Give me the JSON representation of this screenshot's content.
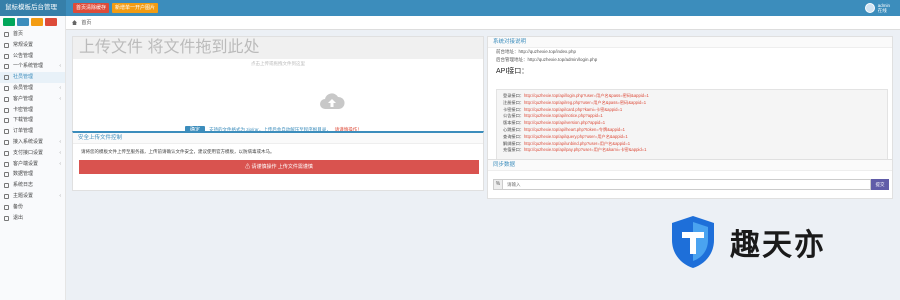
{
  "header": {
    "brand": "鼠标模板后台管理",
    "btn_red": "首页清除缓存",
    "btn_orange": "新增单一开户图片",
    "user_line1": "admin",
    "user_line2": "在线"
  },
  "sidebar": {
    "quick_colors": [
      "#00a65a",
      "#3c8dbc",
      "#f39c12",
      "#dd4b39"
    ],
    "items": [
      {
        "label": "首页",
        "has_children": false
      },
      {
        "label": "常规设置",
        "has_children": false
      },
      {
        "label": "公告管理",
        "has_children": false
      },
      {
        "label": "一个系统管理",
        "has_children": true
      },
      {
        "label": "社员管理",
        "has_children": false
      },
      {
        "label": "会员管理",
        "has_children": true
      },
      {
        "label": "客户管理",
        "has_children": true
      },
      {
        "label": "卡密管理",
        "has_children": false
      },
      {
        "label": "下载管理",
        "has_children": false
      },
      {
        "label": "订单管理",
        "has_children": false
      },
      {
        "label": "接入系统设置",
        "has_children": true
      },
      {
        "label": "支付接口设置",
        "has_children": true
      },
      {
        "label": "客户端设置",
        "has_children": true
      },
      {
        "label": "数据管理",
        "has_children": false
      },
      {
        "label": "系统日志",
        "has_children": false
      },
      {
        "label": "主题设置",
        "has_children": true
      },
      {
        "label": "备份",
        "has_children": false
      },
      {
        "label": "退出",
        "has_children": false
      }
    ]
  },
  "breadcrumb": {
    "label": "首页"
  },
  "upload": {
    "title": "上传文件 将文件拖到此处",
    "hint": "点击上传或拖拽文件到这里",
    "ok_label": "确定",
    "note": "支持的文件格式为 zip/rar，上传后会自动解压至程序根目录，",
    "note_red": "请谨慎操作！"
  },
  "security": {
    "title": "安全上传文件控制",
    "text": "请将您的模板文件上传至服务器，上传前请确认文件安全，建议使用官方模板，以防病毒或木马。",
    "bar_label": "⚠ 请谨慎操作 上传文件需谨慎"
  },
  "info": {
    "title": "系统对接说明",
    "line1": "前台地址：http://quzhexie.top/index.php",
    "line2": "后台管理地址：http://quzhexie.top/admin/login.php",
    "heading": "API接口：",
    "code_lines": [
      {
        "label": "登录接口：",
        "url": "http://quzhexie.top/api/login.php?user=用户名&pass=密码&appid=1"
      },
      {
        "label": "注册接口：",
        "url": "http://quzhexie.top/api/reg.php?user=用户名&pass=密码&appid=1"
      },
      {
        "label": "卡密接口：",
        "url": "http://quzhexie.top/api/card.php?kami=卡密&appid=1"
      },
      {
        "label": "公告接口：",
        "url": "http://quzhexie.top/api/notice.php?appid=1"
      },
      {
        "label": "版本接口：",
        "url": "http://quzhexie.top/api/version.php?appid=1"
      },
      {
        "label": "心跳接口：",
        "url": "http://quzhexie.top/api/heart.php?token=令牌&appid=1"
      },
      {
        "label": "查询接口：",
        "url": "http://quzhexie.top/api/query.php?user=用户名&appid=1"
      },
      {
        "label": "解绑接口：",
        "url": "http://quzhexie.top/api/unbind.php?user=用户名&appid=1"
      },
      {
        "label": "充值接口：",
        "url": "http://quzhexie.top/api/pay.php?user=用户名&kami=卡密&appid=1"
      }
    ]
  },
  "sync": {
    "title": "同步数据",
    "prefix": "%",
    "placeholder": "请输入",
    "button": "提交"
  },
  "watermark": {
    "text": "趣天亦"
  }
}
